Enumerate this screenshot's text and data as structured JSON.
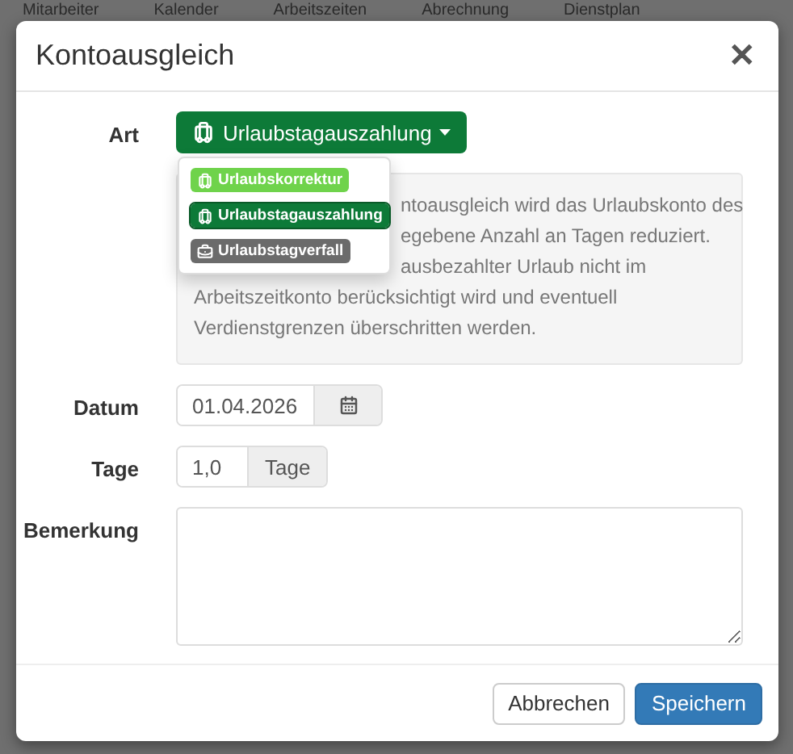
{
  "background_nav": [
    "Mitarbeiter",
    "Kalender",
    "Arbeitszeiten",
    "Abrechnung",
    "Dienstplan"
  ],
  "dialog": {
    "title": "Kontoausgleich",
    "close": "✕",
    "art": {
      "label": "Art",
      "value": "Urlaubstagauszahlung",
      "expanded": true,
      "options": [
        {
          "label": "Urlaubskorrektur",
          "color": "#6fd34b",
          "selected": false
        },
        {
          "label": "Urlaubstagauszahlung",
          "color": "#0d7a38",
          "selected": true
        },
        {
          "label": "Urlaubstagverfall",
          "color": "#6b6b6b",
          "selected": false
        }
      ]
    },
    "info_lines": [
      {
        "text": "ntoausgleich wird das Urlaubskonto des"
      },
      {
        "text": "egebene Anzahl an Tagen reduziert."
      },
      {
        "text": "ausbezahlter Urlaub nicht im"
      },
      {
        "text": "Arbeitszeitkonto berücksichtigt wird und eventuell"
      },
      {
        "text": "Verdienstgrenzen überschritten werden."
      }
    ],
    "datum": {
      "label": "Datum",
      "value": "01.04.2026"
    },
    "tage": {
      "label": "Tage",
      "value": "1,0",
      "unit": "Tage"
    },
    "bemerkung": {
      "label": "Bemerkung"
    },
    "buttons": [
      {
        "label": "Abbrechen",
        "kind": "default"
      },
      {
        "label": "Speichern",
        "kind": "primary"
      }
    ]
  }
}
